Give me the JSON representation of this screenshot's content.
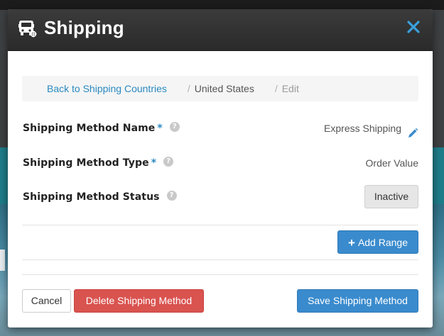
{
  "modal": {
    "title": "Shipping",
    "close_symbol": "×",
    "icon": "truck-icon"
  },
  "breadcrumb": {
    "back_link": "Back to Shipping Countries",
    "separator": "/",
    "country": "United States",
    "current": "Edit"
  },
  "fields": {
    "name": {
      "label": "Shipping Method Name",
      "required_mark": "*",
      "help": "?",
      "value": "Express Shipping"
    },
    "type": {
      "label": "Shipping Method Type",
      "required_mark": "*",
      "help": "?",
      "value": "Order Value"
    },
    "status": {
      "label": "Shipping Method Status",
      "help": "?",
      "value": "Inactive"
    }
  },
  "actions": {
    "add_range": "Add Range",
    "add_range_symbol": "+",
    "cancel": "Cancel",
    "delete": "Delete Shipping Method",
    "save": "Save Shipping Method"
  },
  "colors": {
    "accent_blue": "#3a8bcd",
    "link_blue": "#2a8ac0",
    "danger_red": "#d9534f",
    "header_dark": "#2a2a2a"
  }
}
